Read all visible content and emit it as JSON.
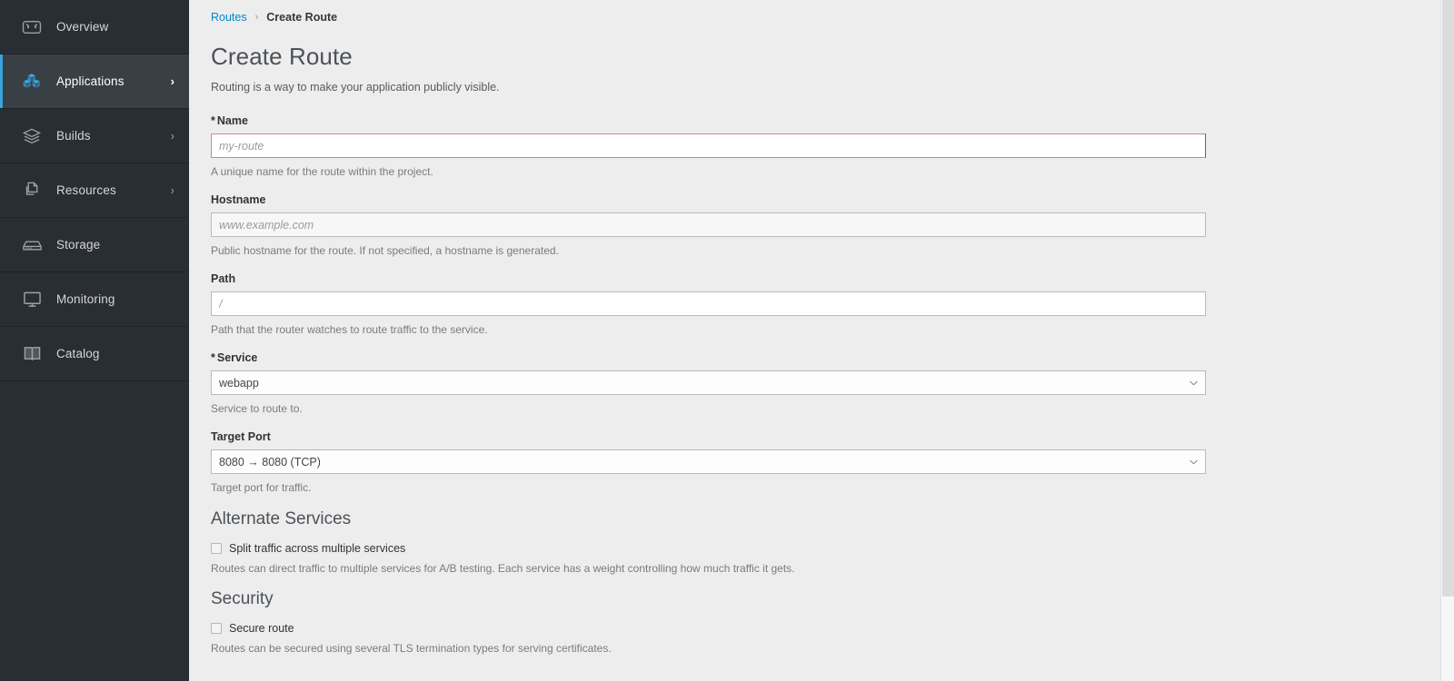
{
  "sidebar": {
    "items": [
      {
        "label": "Overview",
        "icon": "gauge-icon",
        "has_chevron": false,
        "active": false
      },
      {
        "label": "Applications",
        "icon": "cubes-icon",
        "has_chevron": true,
        "active": true
      },
      {
        "label": "Builds",
        "icon": "layers-icon",
        "has_chevron": true,
        "active": false
      },
      {
        "label": "Resources",
        "icon": "copy-files-icon",
        "has_chevron": true,
        "active": false
      },
      {
        "label": "Storage",
        "icon": "database-icon",
        "has_chevron": false,
        "active": false
      },
      {
        "label": "Monitoring",
        "icon": "monitor-icon",
        "has_chevron": false,
        "active": false
      },
      {
        "label": "Catalog",
        "icon": "book-icon",
        "has_chevron": false,
        "active": false
      }
    ],
    "active_accent_color": "#39a5dc",
    "background_color": "#292e34",
    "active_background_color": "#383f45"
  },
  "breadcrumb": {
    "parent": "Routes",
    "separator": "›",
    "current": "Create Route",
    "link_color": "#0088ce"
  },
  "page": {
    "title": "Create Route",
    "subtitle": "Routing is a way to make your application publicly visible."
  },
  "form": {
    "name": {
      "required_marker": "*",
      "label": "Name",
      "placeholder": "my-route",
      "value": "",
      "help": "A unique name for the route within the project.",
      "error_border_color": "#cc8a88"
    },
    "hostname": {
      "label": "Hostname",
      "placeholder": "www.example.com",
      "value": "",
      "help": "Public hostname for the route. If not specified, a hostname is generated."
    },
    "path": {
      "label": "Path",
      "placeholder": "/",
      "value": "",
      "help": "Path that the router watches to route traffic to the service."
    },
    "service": {
      "required_marker": "*",
      "label": "Service",
      "selected": "webapp",
      "help": "Service to route to.",
      "caret": "⌄"
    },
    "target_port": {
      "label": "Target Port",
      "selected": "8080 → 8080 (TCP)",
      "help": "Target port for traffic.",
      "caret": "⌄"
    }
  },
  "alternate_services": {
    "title": "Alternate Services",
    "checkbox_label": "Split traffic across multiple services",
    "checked": false,
    "help": "Routes can direct traffic to multiple services for A/B testing. Each service has a weight controlling how much traffic it gets."
  },
  "security": {
    "title": "Security",
    "checkbox_label": "Secure route",
    "checked": false,
    "help": "Routes can be secured using several TLS termination types for serving certificates."
  }
}
